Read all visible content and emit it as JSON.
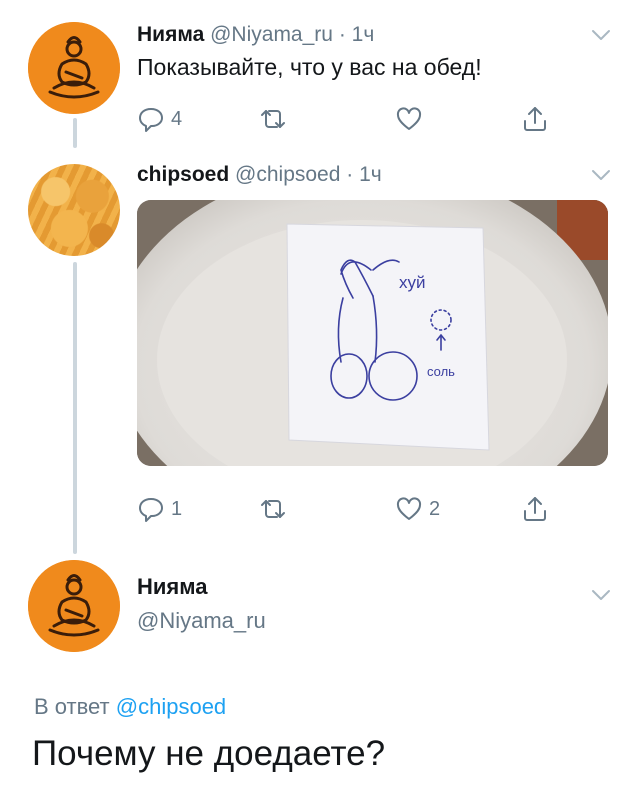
{
  "tweets": [
    {
      "name": "Нияма",
      "handle": "@Niyama_ru",
      "separator": "·",
      "time": "1ч",
      "text": "Показывайте, что у вас на обед!",
      "reply_count": "4",
      "retweet_count": "",
      "like_count": ""
    },
    {
      "name": "chipsoed",
      "handle": "@chipsoed",
      "separator": "·",
      "time": "1ч",
      "reply_count": "1",
      "retweet_count": "",
      "like_count": "2",
      "media": {
        "note_word_top": "хуй",
        "note_word_bottom": "соль"
      }
    }
  ],
  "main_tweet": {
    "name": "Нияма",
    "handle": "@Niyama_ru",
    "reply_prefix": "В ответ",
    "reply_mention": "@chipsoed",
    "text": "Почему не доедаете?"
  },
  "colors": {
    "name": "#14171a",
    "secondary": "#657786",
    "link": "#1da1f2",
    "thread_line": "#ccd6dd",
    "brand_orange": "#f08a1c"
  },
  "icons": {
    "reply": "reply-icon",
    "retweet": "retweet-icon",
    "like": "heart-icon",
    "share": "share-icon",
    "caret": "chevron-down-icon"
  }
}
